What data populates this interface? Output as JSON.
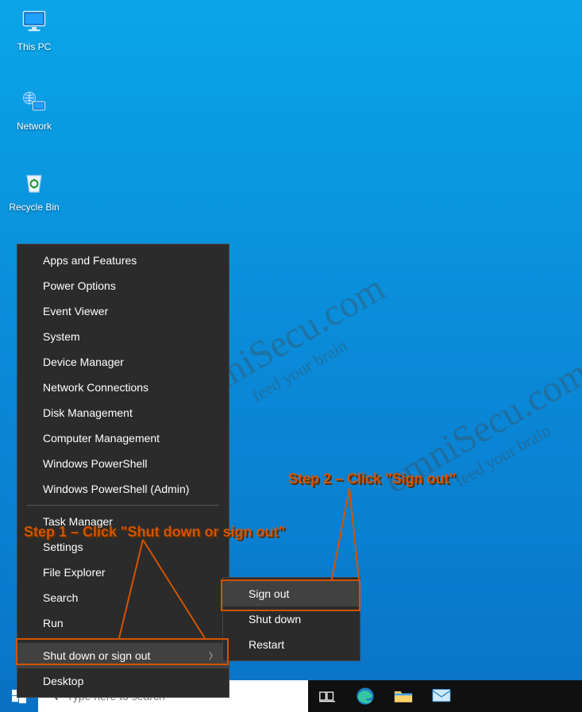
{
  "desktop": {
    "icons": [
      {
        "label": "This PC"
      },
      {
        "label": "Network"
      },
      {
        "label": "Recycle Bin"
      }
    ]
  },
  "winx_menu": {
    "items": [
      "Apps and Features",
      "Power Options",
      "Event Viewer",
      "System",
      "Device Manager",
      "Network Connections",
      "Disk Management",
      "Computer Management",
      "Windows PowerShell",
      "Windows PowerShell (Admin)"
    ],
    "items2": [
      "Task Manager",
      "Settings",
      "File Explorer",
      "Search",
      "Run"
    ],
    "shutdown_label": "Shut down or sign out",
    "desktop_label": "Desktop"
  },
  "sub_menu": {
    "items": [
      "Sign out",
      "Shut down",
      "Restart"
    ]
  },
  "annotations": {
    "step1": "Step 1 – Click \"Shut down or sign out\"",
    "step2": "Step 2 – Click \"Sign out\""
  },
  "watermark": {
    "main": "omniSecu.com",
    "sub": "feed your brain"
  },
  "search": {
    "placeholder": "Type here to search"
  }
}
